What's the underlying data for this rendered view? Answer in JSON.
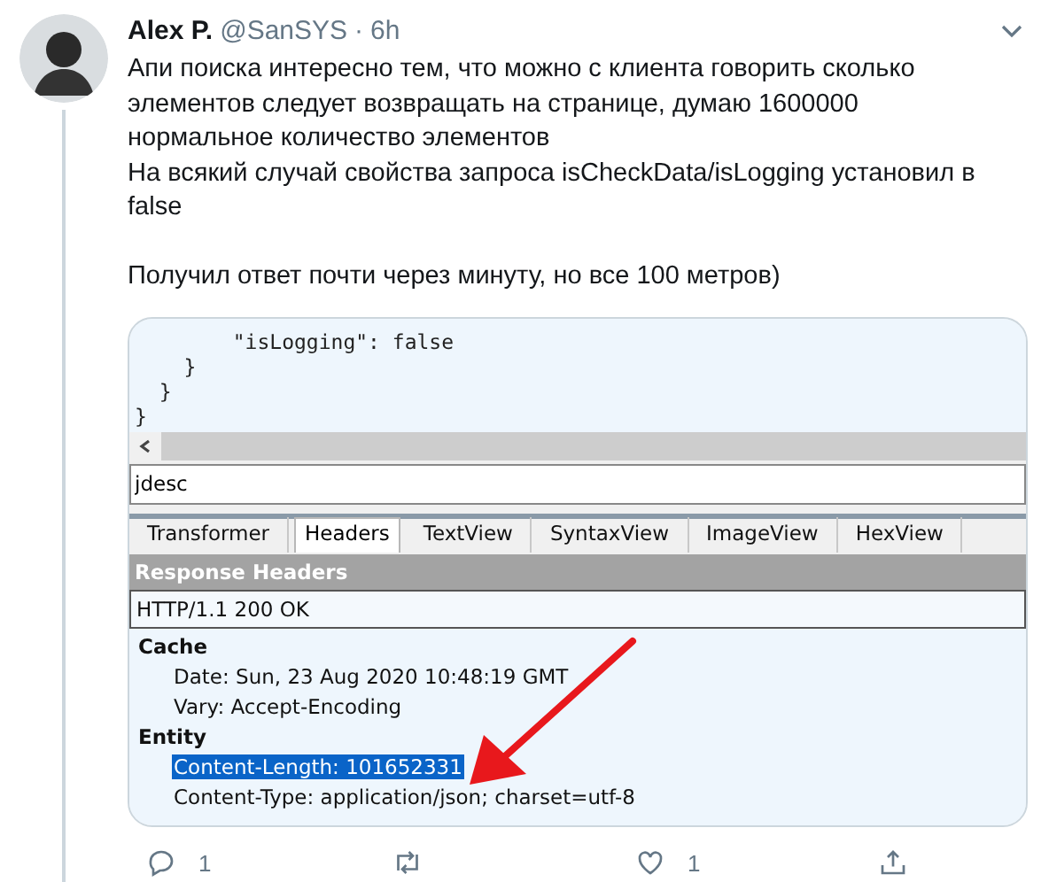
{
  "tweet": {
    "name": "Alex P.",
    "handle": "@SanSYS",
    "separator": "·",
    "time": "6h",
    "paragraphs": [
      {
        "text": "Апи поиска интересно тем, что можно с клиента говорить сколько элементов следует возвращать на странице, думаю 1600000 нормальное количество элементов",
        "gap_before": false
      },
      {
        "text": "На всякий случай свойства запроса isCheckData/isLogging установил в false",
        "gap_before": false
      },
      {
        "text": "Получил ответ почти через минуту, но все 100 метров)",
        "gap_before": true
      }
    ]
  },
  "screenshot": {
    "code_lines": [
      "        \"isLogging\": false",
      "    }",
      "  }",
      "}"
    ],
    "find_value": "jdesc",
    "tabs": [
      {
        "label": "Transformer",
        "selected": false
      },
      {
        "label": "Headers",
        "selected": true
      },
      {
        "label": "TextView",
        "selected": false
      },
      {
        "label": "SyntaxView",
        "selected": false
      },
      {
        "label": "ImageView",
        "selected": false
      },
      {
        "label": "HexView",
        "selected": false
      }
    ],
    "section_title": "Response Headers",
    "status_line": "HTTP/1.1 200 OK",
    "groups": [
      {
        "title": "Cache",
        "headers": [
          {
            "text": "Date: Sun, 23 Aug 2020 10:48:19 GMT",
            "selected": false
          },
          {
            "text": "Vary: Accept-Encoding",
            "selected": false
          }
        ]
      },
      {
        "title": "Entity",
        "headers": [
          {
            "text": "Content-Length: 101652331",
            "selected": true
          },
          {
            "text": "Content-Type: application/json; charset=utf-8",
            "selected": false
          }
        ]
      }
    ]
  },
  "actions": [
    {
      "kind": "reply",
      "count": "1"
    },
    {
      "kind": "retweet"
    },
    {
      "kind": "like",
      "count": "1"
    },
    {
      "kind": "share"
    }
  ]
}
